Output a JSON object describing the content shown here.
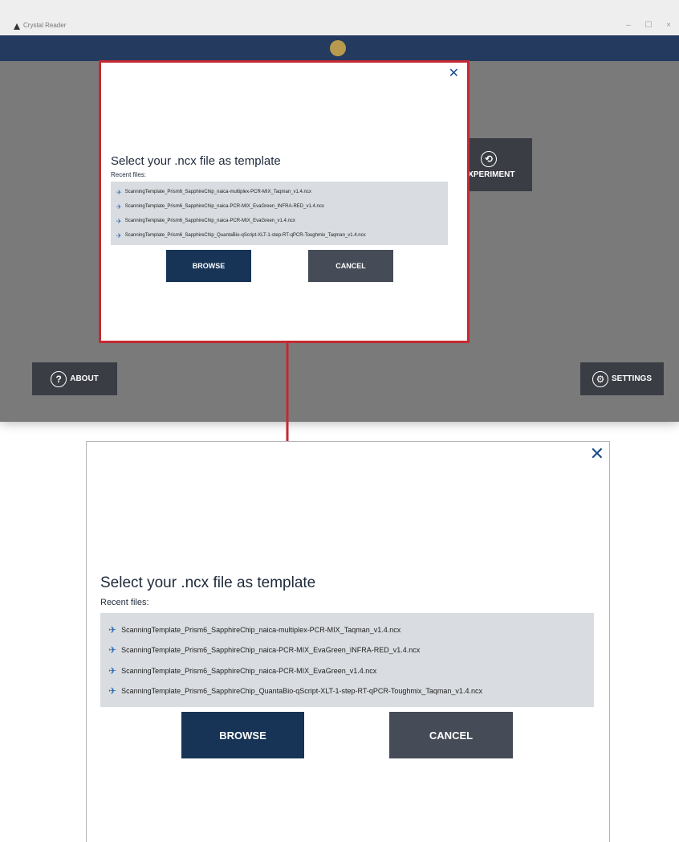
{
  "window": {
    "title": "Crystal Reader",
    "minimize_glyph": "–",
    "maximize_glyph": "☐",
    "close_glyph": "×"
  },
  "home": {
    "experiment_label": "EXPERIMENT",
    "about_label": "ABOUT",
    "settings_label": "SETTINGS"
  },
  "dialog": {
    "close_glyph": "✕",
    "heading": "Select your .ncx file as template",
    "recent_label": "Recent files:",
    "recent_files": [
      "ScanningTemplate_Prism6_SapphireChip_naica-multiplex-PCR-MIX_Taqman_v1.4.ncx",
      "ScanningTemplate_Prism6_SapphireChip_naica-PCR-MIX_EvaGreen_INFRA-RED_v1.4.ncx",
      "ScanningTemplate_Prism6_SapphireChip_naica-PCR-MIX_EvaGreen_v1.4.ncx",
      "ScanningTemplate_Prism6_SapphireChip_QuantaBio-qScript-XLT-1-step-RT-qPCR-Toughmix_Taqman_v1.4.ncx"
    ],
    "browse_label": "BROWSE",
    "cancel_label": "CANCEL",
    "pin_icon": "pin-icon"
  },
  "colors": {
    "header_navy": "#243a5e",
    "browse_navy": "#173457",
    "cancel_gray": "#464c57",
    "highlight_red": "#c42a33",
    "close_blue": "#1c4f8e",
    "pin_blue": "#2a6bb8"
  }
}
